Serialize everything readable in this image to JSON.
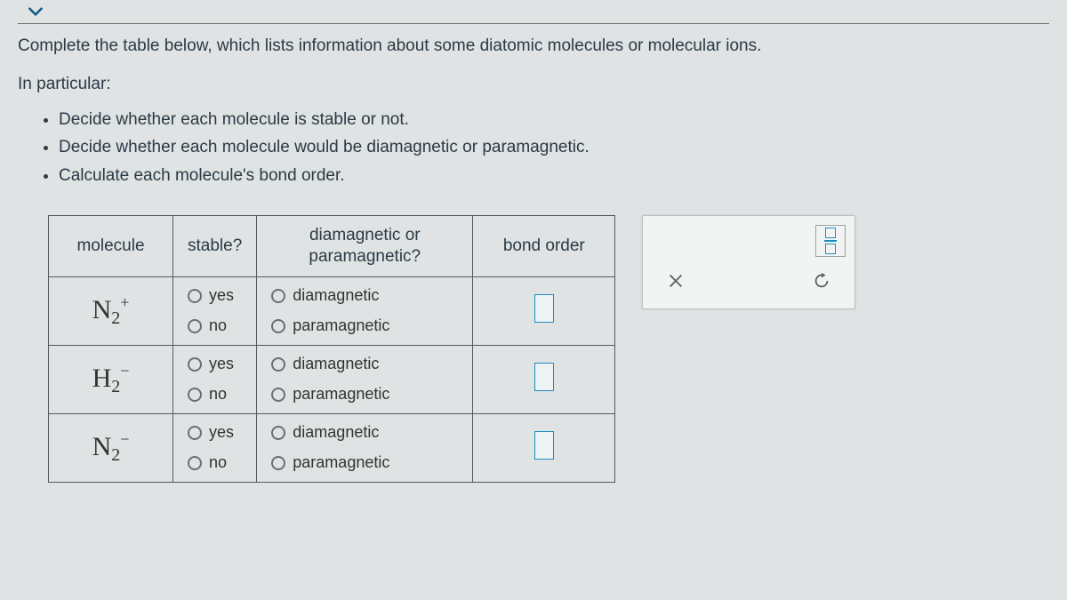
{
  "question": {
    "intro": "Complete the table below, which lists information about some diatomic molecules or molecular ions.",
    "lead2": "In particular:",
    "bullets": [
      "Decide whether each molecule is stable or not.",
      "Decide whether each molecule would be diamagnetic or paramagnetic.",
      "Calculate each molecule's bond order."
    ]
  },
  "table": {
    "headers": {
      "molecule": "molecule",
      "stable": "stable?",
      "magnetic": "diamagnetic or paramagnetic?",
      "bond": "bond order"
    },
    "options": {
      "yes": "yes",
      "no": "no",
      "dia": "diamagnetic",
      "para": "paramagnetic"
    },
    "rows": [
      {
        "base": "N",
        "sub": "2",
        "sup": "+"
      },
      {
        "base": "H",
        "sub": "2",
        "sup": "−"
      },
      {
        "base": "N",
        "sub": "2",
        "sup": "−"
      }
    ]
  },
  "tools": {
    "fraction": "fraction",
    "clear": "clear",
    "reset": "reset"
  }
}
